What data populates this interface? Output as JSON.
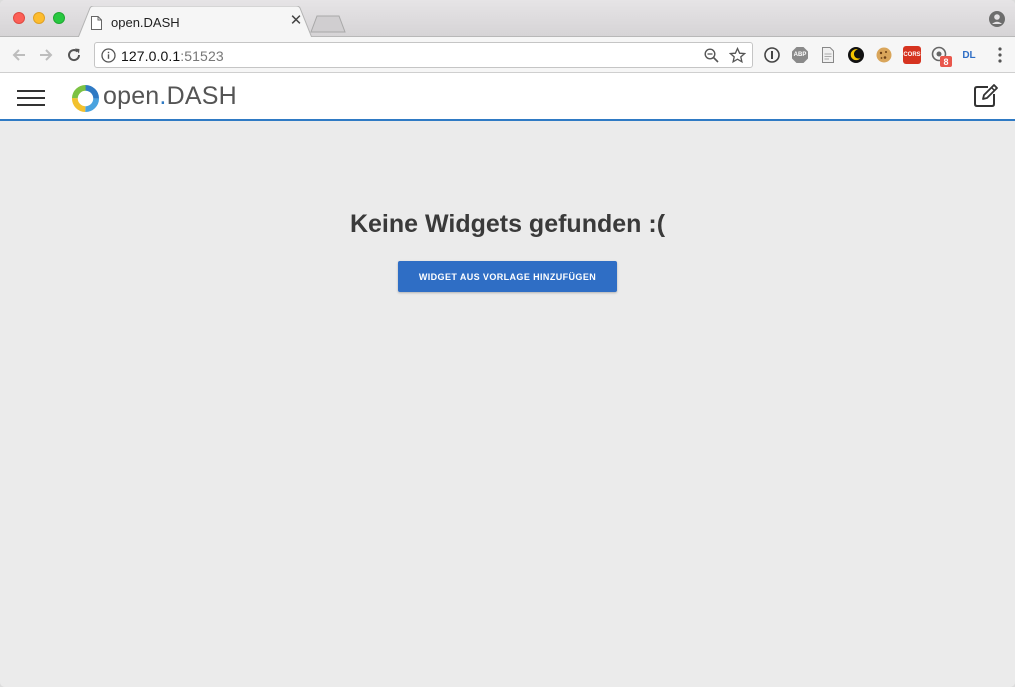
{
  "browser": {
    "tab_title": "open.DASH",
    "url_host": "127.0.0.1",
    "url_port": ":51523",
    "extensions": [
      {
        "name": "abp",
        "label": "ABP",
        "color": "#8a8a8a"
      },
      {
        "name": "cors",
        "label": "CORS",
        "color": "#d6331f"
      },
      {
        "name": "dl",
        "label": "DL",
        "color": "#2f6ec5"
      },
      {
        "name": "badge",
        "label": "8",
        "color": "#e9564b"
      }
    ]
  },
  "app": {
    "logo_prefix": "open",
    "logo_dot": ".",
    "logo_suffix": "DASH"
  },
  "main": {
    "empty_message": "Keine Widgets gefunden :(",
    "add_button_label": "WIDGET AUS VORLAGE HINZUFÜGEN"
  }
}
